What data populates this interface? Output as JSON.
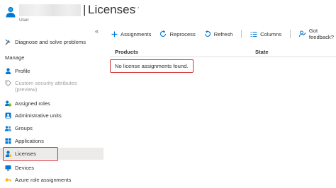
{
  "header": {
    "title": "Licenses",
    "separator": "|",
    "subtitle": "User",
    "more": "···"
  },
  "sidebar": {
    "collapse": "«",
    "top_item": "Diagnose and solve problems",
    "section_manage": "Manage",
    "items": [
      {
        "label": "Profile",
        "icon": "person-icon"
      },
      {
        "label": "Custom security attributes (preview)",
        "icon": "tag-icon",
        "disabled": true
      },
      {
        "label": "Assigned roles",
        "icon": "roles-icon"
      },
      {
        "label": "Administrative units",
        "icon": "admin-units-icon"
      },
      {
        "label": "Groups",
        "icon": "groups-icon"
      },
      {
        "label": "Applications",
        "icon": "grid-icon"
      },
      {
        "label": "Licenses",
        "icon": "license-icon",
        "active": true
      },
      {
        "label": "Devices",
        "icon": "device-icon"
      },
      {
        "label": "Azure role assignments",
        "icon": "key-icon"
      }
    ]
  },
  "toolbar": {
    "assignments": "Assignments",
    "reprocess": "Reprocess",
    "refresh": "Refresh",
    "columns": "Columns",
    "feedback": "Got feedback?"
  },
  "table": {
    "col_products": "Products",
    "col_state": "State",
    "empty": "No license assignments found."
  },
  "colors": {
    "accent": "#0078d4",
    "highlight_border": "#d13438",
    "active_bg": "#edebe9"
  }
}
